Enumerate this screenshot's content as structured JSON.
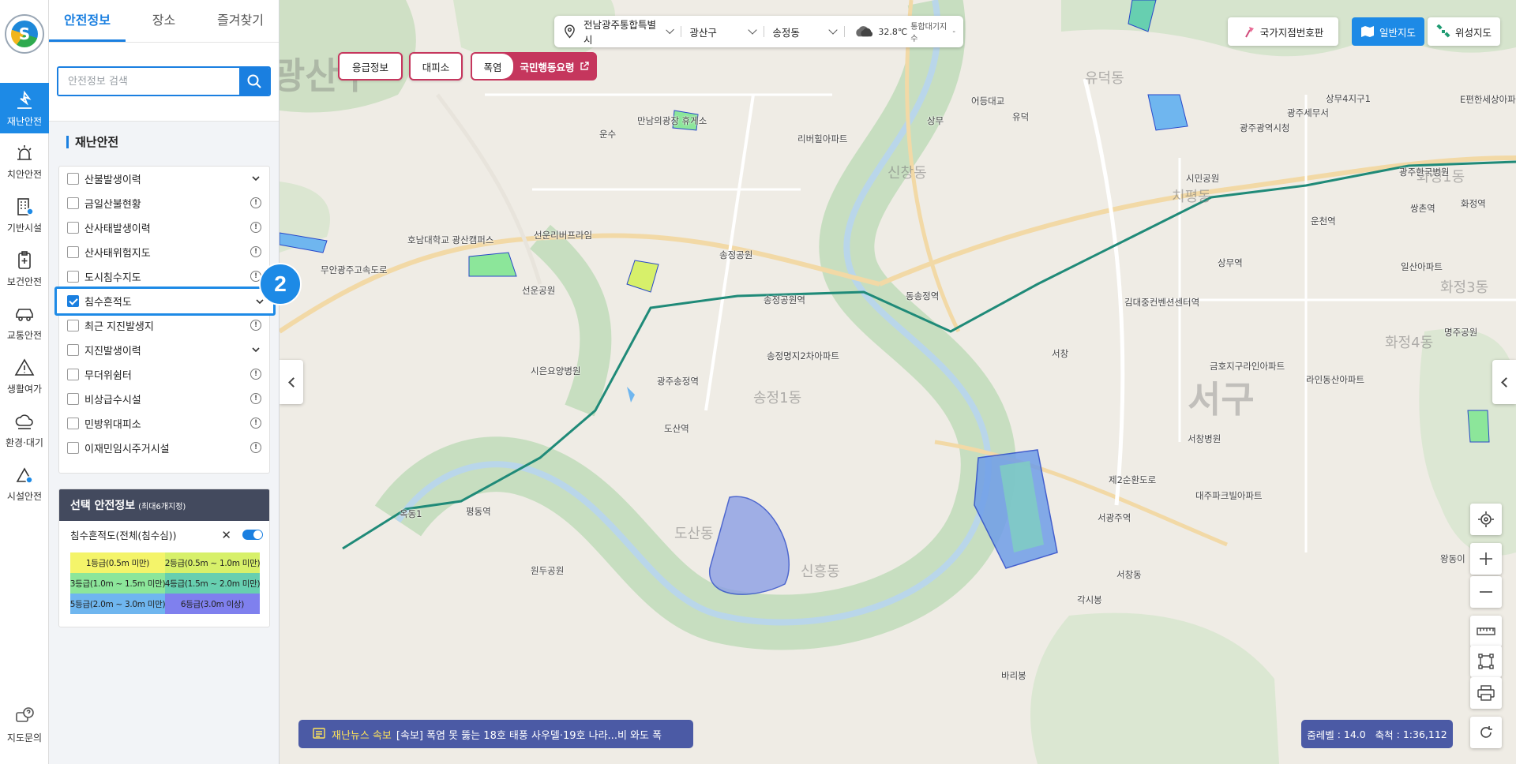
{
  "rail": {
    "items": [
      {
        "label": "재난안전",
        "icon": "hazard-warning-icon"
      },
      {
        "label": "치안안전",
        "icon": "police-siren-icon"
      },
      {
        "label": "기반시설",
        "icon": "building-icon"
      },
      {
        "label": "보건안전",
        "icon": "clipboard-medical-icon"
      },
      {
        "label": "교통안전",
        "icon": "car-icon"
      },
      {
        "label": "생활여가",
        "icon": "warning-triangle-icon"
      },
      {
        "label": "환경·대기",
        "icon": "cloud-icon"
      },
      {
        "label": "시설안전",
        "icon": "facility-check-icon"
      },
      {
        "label": "지도문의",
        "icon": "help-chat-icon"
      }
    ]
  },
  "tabs": [
    "안전정보",
    "장소",
    "즐겨찾기"
  ],
  "search": {
    "placeholder": "안전정보 검색",
    "value": ""
  },
  "section_title": "재난안전",
  "layers": [
    {
      "label": "산불발생이력",
      "checked": false,
      "right": "chevron"
    },
    {
      "label": "금일산불현황",
      "checked": false,
      "right": "info"
    },
    {
      "label": "산사태발생이력",
      "checked": false,
      "right": "info"
    },
    {
      "label": "산사태위험지도",
      "checked": false,
      "right": "info"
    },
    {
      "label": "도시침수지도",
      "checked": false,
      "right": "info"
    },
    {
      "label": "침수흔적도",
      "checked": true,
      "right": "chevron"
    },
    {
      "label": "최근 지진발생지",
      "checked": false,
      "right": "info"
    },
    {
      "label": "지진발생이력",
      "checked": false,
      "right": "chevron"
    },
    {
      "label": "무더위쉼터",
      "checked": false,
      "right": "info"
    },
    {
      "label": "비상급수시설",
      "checked": false,
      "right": "info"
    },
    {
      "label": "민방위대피소",
      "checked": false,
      "right": "info"
    },
    {
      "label": "이재민임시주거시설",
      "checked": false,
      "right": "info"
    }
  ],
  "step_badge": "2",
  "selected": {
    "title": "선택 안전정보",
    "subtitle": "(최대6개지정)",
    "layer_name": "침수흔적도(전체(침수심))",
    "close": "✕",
    "enabled": true,
    "legend": [
      {
        "label": "1등급(0.5m 미만)",
        "color": "#f4f46a"
      },
      {
        "label": "2등급(0.5m ~ 1.0m 미만)",
        "color": "#d7f06a"
      },
      {
        "label": "3등급(1.0m ~ 1.5m 미만)",
        "color": "#8ce69a"
      },
      {
        "label": "4등급(1.5m ~ 2.0m 미만)",
        "color": "#67cfb0"
      },
      {
        "label": "5등급(2.0m ~ 3.0m 미만)",
        "color": "#6fb6ef"
      },
      {
        "label": "6등급(3.0m 이상)",
        "color": "#7f80ee"
      }
    ]
  },
  "location_bar": {
    "region": "전남광주통합특별시",
    "district": "광산구",
    "dong": "송정동",
    "temperature": "32.8℃",
    "air_label": "통합대기지수",
    "air_value": "-"
  },
  "alerts": {
    "emergency": "응급정보",
    "shelter": "대피소",
    "heat": "폭염",
    "guide": "국민행동요령"
  },
  "map_buttons": {
    "national_point": "국가지점번호판",
    "general": "일반지도",
    "satellite": "위성지도"
  },
  "news": {
    "tag": "재난뉴스 속보",
    "text": "[속보] 폭염 못 뚫는 18호 태풍 사우델·19호 나라...비 와도 폭"
  },
  "scale": {
    "zoom_label": "줌레벨",
    "zoom": "14.0",
    "scale_label": "축척",
    "scale_value": "1:36,112"
  },
  "map_labels": {
    "big": [
      "광산구",
      "서구"
    ],
    "mid": [
      "송정1동",
      "신흥동",
      "도산동",
      "치평동",
      "화정1동",
      "화정3동",
      "화정4동",
      "유덕동",
      "신창동"
    ],
    "places": [
      "송정공원",
      "선운공원",
      "원두공원",
      "시은요양병원",
      "송정명지2차아파트",
      "광주송정역",
      "도산역",
      "송정공원역",
      "동송정역",
      "김대중컨벤션센터역",
      "상무역",
      "운천역",
      "쌍촌역",
      "화정역",
      "서창",
      "서광주역",
      "서창병원",
      "금호지구라인아파트",
      "대주파크빌아파트",
      "라인동산아파트",
      "광주한국병원",
      "시민공원",
      "광주광역시청",
      "상무4지구1",
      "리버힐아파트",
      "만남의광장 휴게소",
      "호남대학교 광산캠퍼스",
      "선운리버프라임",
      "일산아파트",
      "평동역",
      "옥동1",
      "바리봉",
      "각시봉",
      "상무",
      "운수",
      "어등대교",
      "유덕",
      "광주세무서",
      "제2순환도로",
      "무안광주고속도로",
      "명주공원",
      "왕동이",
      "서창동",
      "E편한세상아파트"
    ]
  }
}
